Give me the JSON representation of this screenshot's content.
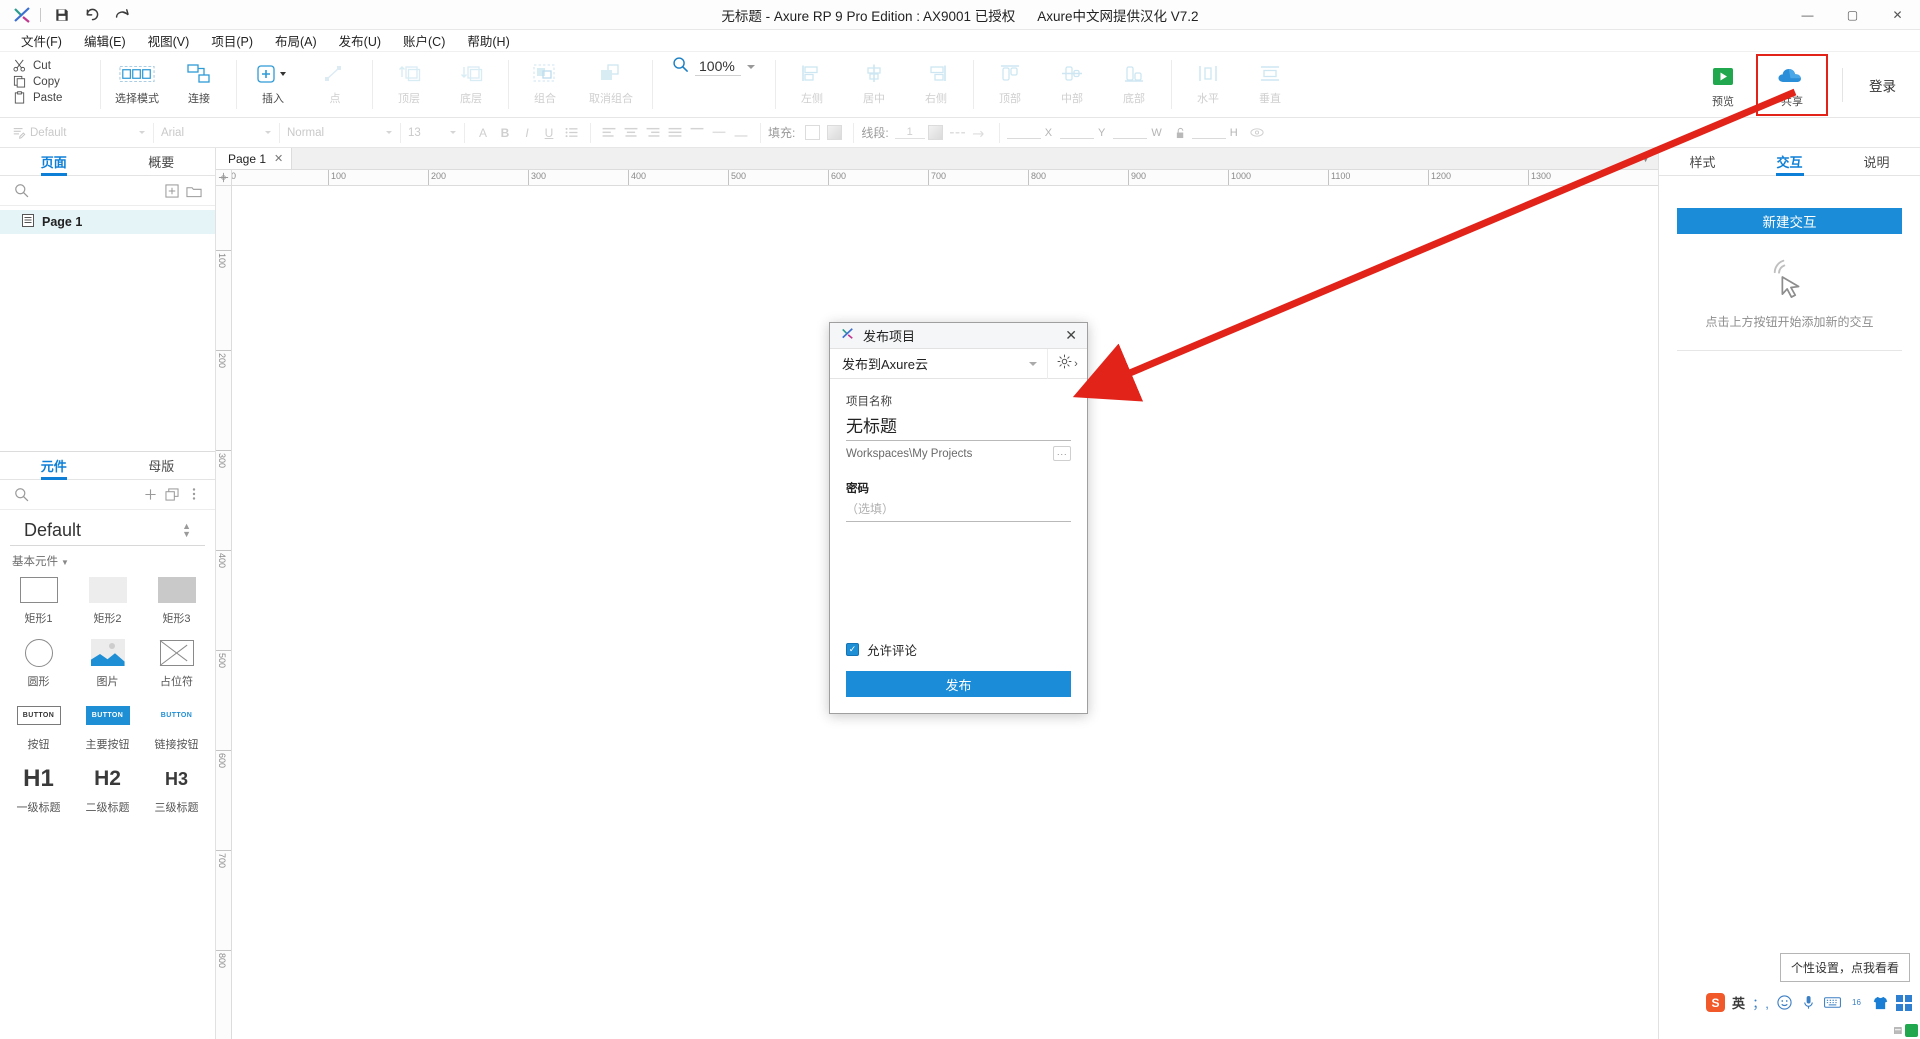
{
  "window": {
    "title_doc": "无标题",
    "title_app": " - Axure RP 9 Pro Edition : AX9001 已授权",
    "title_extra": "Axure中文网提供汉化 V7.2",
    "minimize": "—",
    "maximize": "▢",
    "close": "✕"
  },
  "titlebar_icons": {
    "save": "save-icon",
    "undo": "↺",
    "redo": "↷"
  },
  "menu": [
    {
      "label": "文件(F)",
      "key": "F"
    },
    {
      "label": "编辑(E)",
      "key": "E"
    },
    {
      "label": "视图(V)",
      "key": "V"
    },
    {
      "label": "项目(P)",
      "key": "P"
    },
    {
      "label": "布局(A)",
      "key": "A"
    },
    {
      "label": "发布(U)",
      "key": "U"
    },
    {
      "label": "账户(C)",
      "key": "C"
    },
    {
      "label": "帮助(H)",
      "key": "H"
    }
  ],
  "clipboard": [
    {
      "label": "Cut",
      "icon": "scissors-icon"
    },
    {
      "label": "Copy",
      "icon": "copy-icon"
    },
    {
      "label": "Paste",
      "icon": "clipboard-icon"
    }
  ],
  "toolbar": {
    "select_mode": "选择模式",
    "connect": "连接",
    "insert": "插入",
    "point": "点",
    "bring_front": "顶层",
    "send_back": "底层",
    "group": "组合",
    "ungroup": "取消组合",
    "zoom_value": "100%",
    "align_left": "左侧",
    "align_center": "居中",
    "align_right": "右侧",
    "align_top": "顶部",
    "align_middle": "中部",
    "align_bottom": "底部",
    "dist_h": "水平",
    "dist_v": "垂直",
    "preview": "预览",
    "share": "共享",
    "login": "登录"
  },
  "formatbar": {
    "style": "Default",
    "font": "Arial",
    "weight": "Normal",
    "size": "13",
    "fill_label": "填充:",
    "line_label": "线段:",
    "line_width": "1",
    "x": "X",
    "y": "Y",
    "w": "W",
    "h": "H"
  },
  "left_panel": {
    "tabs": [
      {
        "label": "页面",
        "active": true
      },
      {
        "label": "概要",
        "active": false
      }
    ],
    "search_placeholder": "",
    "pages": [
      {
        "label": "Page 1",
        "selected": true
      }
    ],
    "lib_tabs": [
      {
        "label": "元件",
        "active": true
      },
      {
        "label": "母版",
        "active": false
      }
    ],
    "library_name": "Default",
    "category": "基本元件",
    "widgets": [
      {
        "label": "矩形1",
        "kind": "rect1"
      },
      {
        "label": "矩形2",
        "kind": "rect2"
      },
      {
        "label": "矩形3",
        "kind": "rect3"
      },
      {
        "label": "圆形",
        "kind": "circle"
      },
      {
        "label": "图片",
        "kind": "image"
      },
      {
        "label": "占位符",
        "kind": "placeholder"
      },
      {
        "label": "按钮",
        "kind": "button"
      },
      {
        "label": "主要按钮",
        "kind": "button-primary"
      },
      {
        "label": "链接按钮",
        "kind": "button-link"
      },
      {
        "label": "一级标题",
        "kind": "h1",
        "glyph": "H1"
      },
      {
        "label": "二级标题",
        "kind": "h2",
        "glyph": "H2"
      },
      {
        "label": "三级标题",
        "kind": "h3",
        "glyph": "H3"
      }
    ]
  },
  "canvas": {
    "page_tab": "Page 1",
    "page_tab_close": "✕",
    "ruler_h": [
      "0",
      "100",
      "200",
      "300",
      "400",
      "500",
      "600",
      "700",
      "800",
      "900",
      "1000",
      "1100",
      "1200",
      "1300"
    ],
    "ruler_v": [
      "100",
      "200",
      "300",
      "400",
      "500",
      "600",
      "700",
      "800"
    ]
  },
  "dialog": {
    "title": "发布项目",
    "close": "✕",
    "target": "发布到Axure云",
    "gear_icon": "gear-icon",
    "gear_chevron": "›",
    "project_name_label": "项目名称",
    "project_name_value": "无标题",
    "workspace_path": "Workspaces\\My Projects",
    "browse_label": "···",
    "password_label": "密码",
    "password_placeholder": "（选填）",
    "allow_comments": "允许评论",
    "allow_comments_checked": true,
    "publish_button": "发布"
  },
  "right_panel": {
    "tabs": [
      {
        "label": "样式",
        "active": false
      },
      {
        "label": "交互",
        "active": true
      },
      {
        "label": "说明",
        "active": false
      }
    ],
    "new_interaction": "新建交互",
    "empty_hint": "点击上方按钮开始添加新的交互",
    "empty_icon": "click-cursor-icon"
  },
  "ime": {
    "tooltip": "个性设置，点我看看",
    "logo": "S",
    "mode": "英",
    "items": [
      "；,",
      "☺",
      "🎤",
      "⌨",
      "16",
      "👕",
      "⊞"
    ]
  },
  "colors": {
    "accent": "#1b8cd8",
    "tab_active": "#0d7fd6",
    "highlight_red": "#e2231a",
    "page_selected": "#e4f4f7",
    "preview_green": "#21a84f"
  }
}
